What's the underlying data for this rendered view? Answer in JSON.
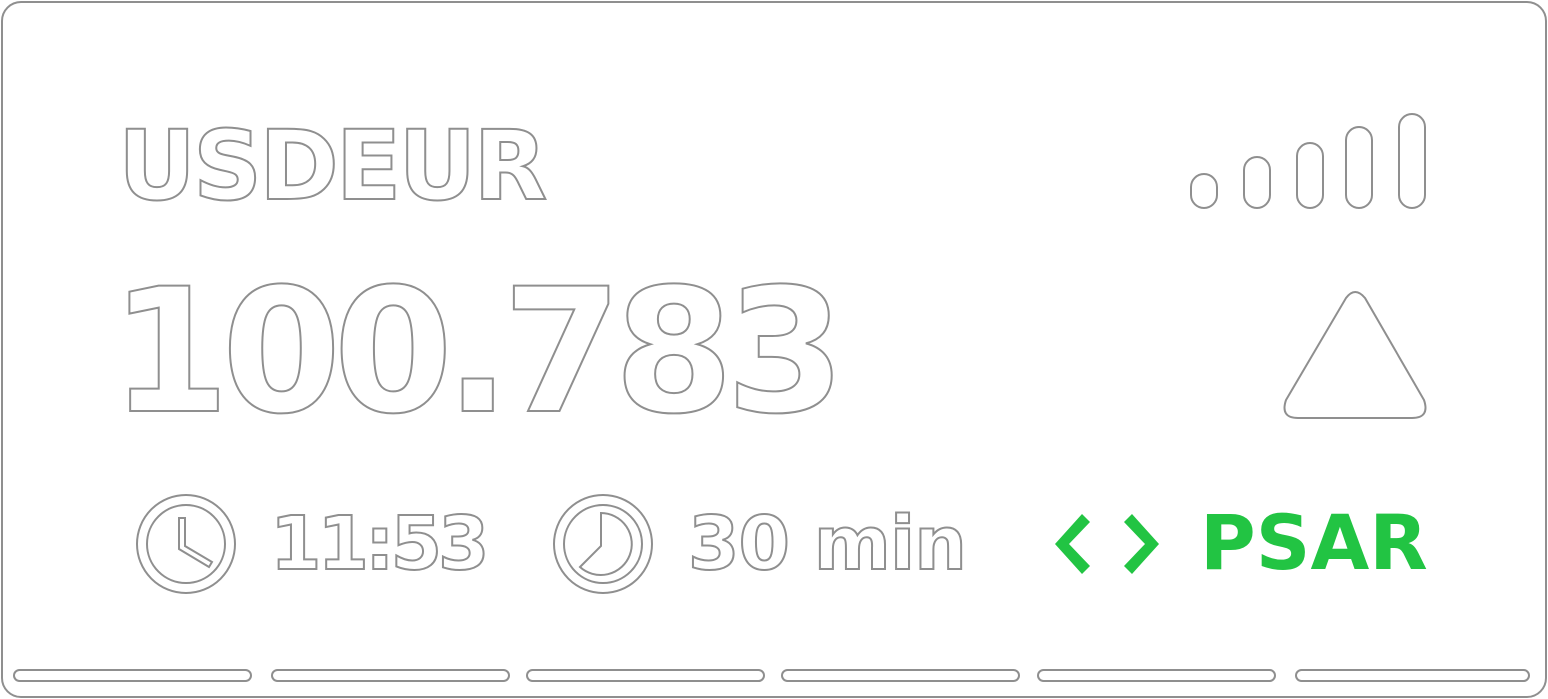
{
  "ticker": {
    "symbol": "USDEUR",
    "price": "100.783",
    "signal_strength_bars": 5,
    "direction_icon": "triangle-up-icon"
  },
  "footer": {
    "clock_icon": "clock-icon",
    "time": "11:53",
    "timer_icon": "timer-icon",
    "interval": "30 min",
    "indicator_icon": "code-brackets-icon",
    "indicator": "PSAR"
  },
  "pager": {
    "segments": 6
  },
  "colors": {
    "outline": "#8f8f8f",
    "fill": "#ffffff",
    "accent": "#22c443"
  }
}
